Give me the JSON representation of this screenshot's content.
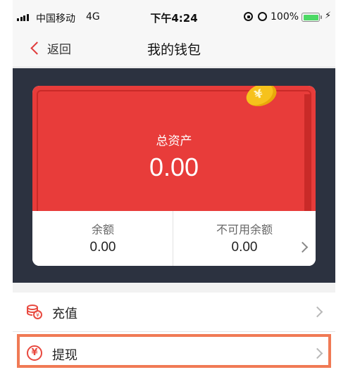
{
  "status_bar": {
    "carrier": "中国移动",
    "network": "4G",
    "time": "下午4:24",
    "battery_percent": "100%",
    "battery_level": 1.0,
    "icons": [
      "signal-icon",
      "rotation-lock-icon",
      "alarm-icon",
      "battery-icon",
      "charging-icon"
    ]
  },
  "nav": {
    "back_label": "返回",
    "title": "我的钱包"
  },
  "wallet": {
    "total_label": "总资产",
    "total_value": "0.00",
    "balance_label": "余额",
    "balance_value": "0.00",
    "unavailable_label": "不可用余额",
    "unavailable_value": "0.00"
  },
  "menu": {
    "items": [
      {
        "label": "充值",
        "icon": "coin-stack-icon"
      },
      {
        "label": "提现",
        "icon": "yen-circle-icon"
      }
    ]
  },
  "colors": {
    "card_red": "#e83c3a",
    "dark_bg": "#2c3240",
    "accent": "#e03b3b",
    "highlight": "#f07a55",
    "coin": "#f6c21c"
  }
}
